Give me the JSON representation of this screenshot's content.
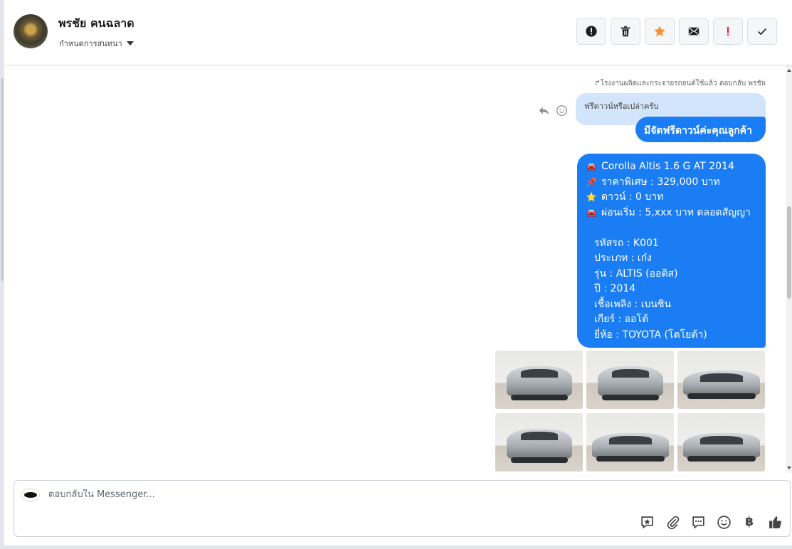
{
  "header": {
    "contact_name": "พรชัย คนฉลาด",
    "assign_label": "กำหนดการสนทนา",
    "actions": [
      {
        "name": "alert-button",
        "icon": "alert-circle-icon"
      },
      {
        "name": "delete-button",
        "icon": "trash-icon"
      },
      {
        "name": "star-button",
        "icon": "star-icon"
      },
      {
        "name": "mail-button",
        "icon": "envelope-icon"
      },
      {
        "name": "priority-button",
        "icon": "exclamation-icon"
      },
      {
        "name": "done-button",
        "icon": "check-icon"
      }
    ],
    "star_color": "#f7923a",
    "priority_color": "#e41e3f"
  },
  "thread": {
    "reply_meta": "โรงงานผลิตและกระจายรถยนต์ใช้แล้ว ตอบกลับ พรชัย",
    "quoted_text": "ฟรีดาวน์หรือเปล่าครับ",
    "reply_bubble": "มีจัดฟรีดาวน์ค่ะคุณลูกค้า",
    "listing": {
      "lines": [
        {
          "icon": "car-icon",
          "emoji": "🚘",
          "text": "Corolla Altis 1.6 G  AT 2014"
        },
        {
          "icon": "pin-icon",
          "emoji": "📌",
          "text": "ราคาพิเศษ : 329,000 บาท"
        },
        {
          "icon": "star-icon",
          "emoji": "⭐",
          "text": "ดาวน์ : 0 บาท"
        },
        {
          "icon": "car-icon",
          "emoji": "🚘",
          "text": "ผ่อนเริ่ม : 5,xxx บาท ตลอดสัญญา"
        }
      ],
      "specs": [
        "รหัสรถ : K001",
        "ประเภท : เก๋ง",
        "รุ่น : ALTIS (ออติส)",
        "ปี : 2014",
        "เชื้อเพลิง : เบนซิน",
        "เกียร์ : ออโต้",
        "ยี่ห้อ : TOYOTA (โตโยต้า)"
      ]
    },
    "photos": [
      "car-front-photo",
      "car-front-angle-photo",
      "car-rear-angle-photo",
      "car-rear-photo",
      "car-rear-side-photo",
      "car-side-photo"
    ],
    "bubble_color": "#1a7df3",
    "quoted_color": "#d3e5fb"
  },
  "composer": {
    "placeholder": "ตอบกลับใน Messenger...",
    "tools": [
      "saved-reply-icon",
      "attachment-icon",
      "quick-reply-icon",
      "emoji-icon",
      "baht-icon",
      "like-icon"
    ],
    "baht_symbol": "฿"
  }
}
